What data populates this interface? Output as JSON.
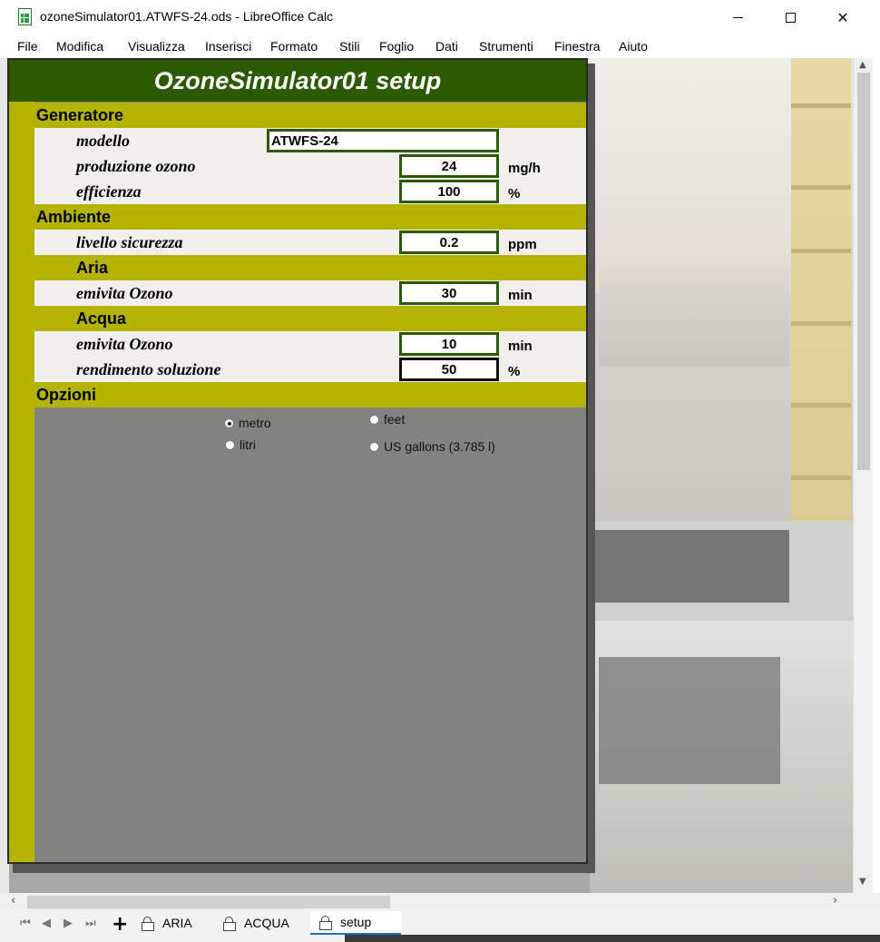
{
  "window": {
    "title": "ozoneSimulator01.ATWFS-24.ods - LibreOffice Calc"
  },
  "menu": [
    "File",
    "Modifica",
    "Visualizza",
    "Inserisci",
    "Formato",
    "Stili",
    "Foglio",
    "Dati",
    "Strumenti",
    "Finestra",
    "Aiuto"
  ],
  "form": {
    "title": "OzoneSimulator01 setup",
    "sections": {
      "generatore": "Generatore",
      "ambiente": "Ambiente",
      "aria": "Aria",
      "acqua": "Acqua",
      "opzioni": "Opzioni"
    },
    "fields": {
      "modello": {
        "label": "modello",
        "value": "ATWFS-24"
      },
      "produzione_ozono": {
        "label": "produzione ozono",
        "value": "24",
        "unit": "mg/h"
      },
      "efficienza": {
        "label": "efficienza",
        "value": "100",
        "unit": "%"
      },
      "livello_sicurezza": {
        "label": "livello sicurezza",
        "value": "0.2",
        "unit": "ppm"
      },
      "aria_emivita": {
        "label": "emivita Ozono",
        "value": "30",
        "unit": "min"
      },
      "acqua_emivita": {
        "label": "emivita Ozono",
        "value": "10",
        "unit": "min"
      },
      "rendimento_soluzione": {
        "label": "rendimento soluzione",
        "value": "50",
        "unit": "%"
      }
    },
    "options": {
      "metro": {
        "label": "metro",
        "selected": true
      },
      "litri": {
        "label": "litri",
        "selected": false
      },
      "feet": {
        "label": "feet",
        "selected": false
      },
      "us_gallons": {
        "label": "US gallons (3.785 l)",
        "selected": false
      }
    }
  },
  "sheet_tabs": [
    {
      "label": "ARIA",
      "active": false
    },
    {
      "label": "ACQUA",
      "active": false
    },
    {
      "label": "setup",
      "active": true
    }
  ],
  "colors": {
    "title_band": "#2c5a00",
    "section_band": "#b3b300",
    "field_bg": "#f0efed",
    "box_border": "#2c5a00"
  }
}
